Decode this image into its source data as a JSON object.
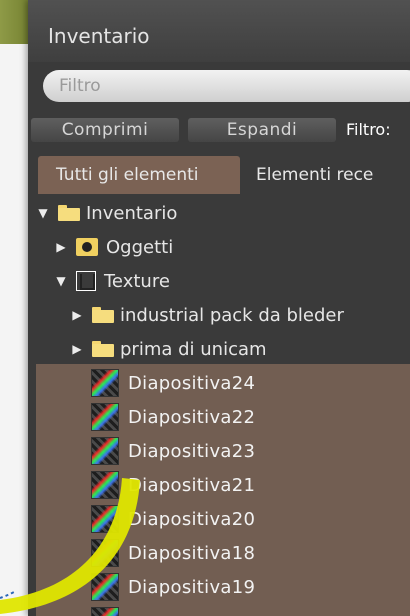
{
  "panel": {
    "title": "Inventario"
  },
  "filter": {
    "placeholder": "Filtro"
  },
  "buttons": {
    "collapse": "Comprimi",
    "expand": "Espandi"
  },
  "filter_status": "Filtro:",
  "tabs": [
    {
      "label": "Tutti gli elementi",
      "active": true
    },
    {
      "label": "Elementi rece"
    }
  ],
  "tree": {
    "root": "Inventario",
    "objects": "Oggetti",
    "textures": "Texture",
    "subfolders": [
      "industrial pack da bleder",
      "prima di unicam"
    ]
  },
  "items": [
    "Diapositiva24",
    "Diapositiva22",
    "Diapositiva23",
    "Diapositiva21",
    "Diapositiva20",
    "Diapositiva18",
    "Diapositiva19"
  ],
  "colors": {
    "selection": "#725e52",
    "panel": "#3a3a3a",
    "annotation": "#f2e600"
  }
}
